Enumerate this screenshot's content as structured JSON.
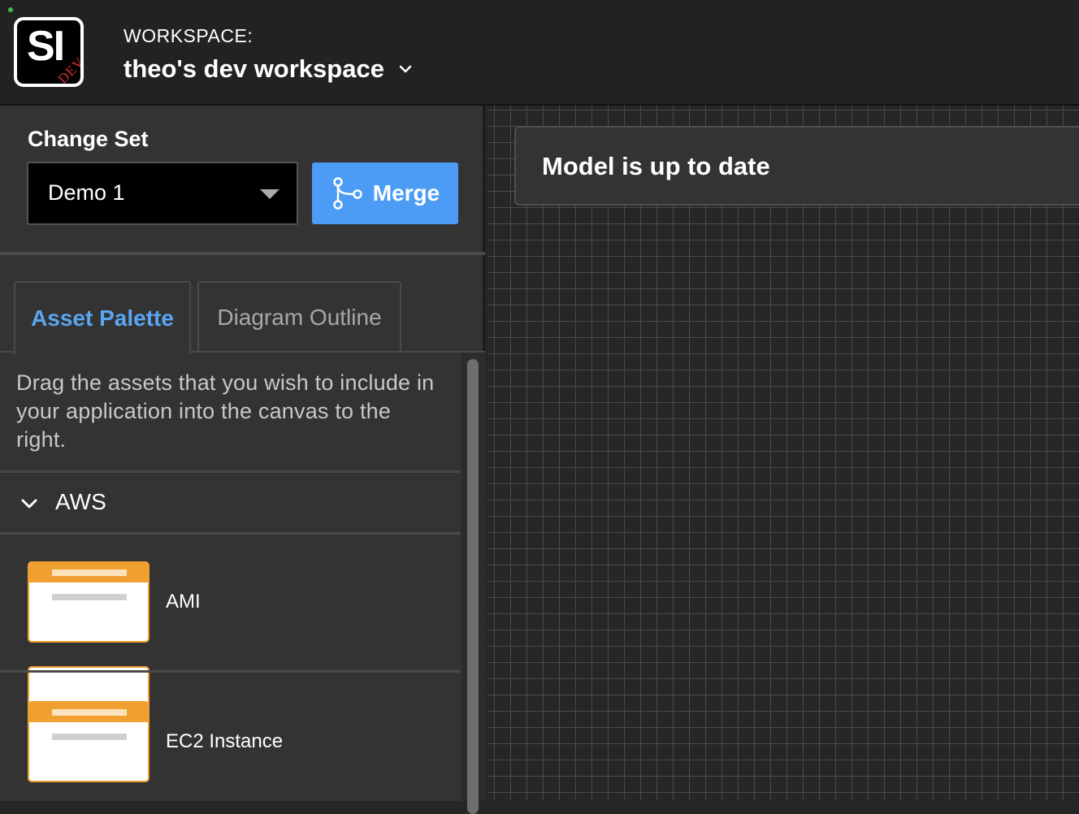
{
  "header": {
    "logo_text": "SI",
    "logo_badge": "DEV",
    "workspace_label": "WORKSPACE:",
    "workspace_name": "theo's dev workspace"
  },
  "change_set": {
    "title": "Change Set",
    "selected": "Demo 1",
    "merge_label": "Merge"
  },
  "tabs": [
    {
      "label": "Asset Palette",
      "active": true
    },
    {
      "label": "Diagram Outline",
      "active": false
    }
  ],
  "palette": {
    "description": "Drag the assets that you wish to include in your application into the canvas to the right.",
    "groups": [
      {
        "label": "AWS",
        "expanded": true,
        "items": [
          {
            "label": "AMI"
          },
          {
            "label": "EC2 Instance"
          }
        ]
      }
    ]
  },
  "canvas": {
    "status": "Model is up to date"
  },
  "colors": {
    "accent": "#4c9cf5",
    "active_tab": "#5aa6f2",
    "asset_orange": "#f0a030",
    "logo_badge": "#e0282f"
  }
}
